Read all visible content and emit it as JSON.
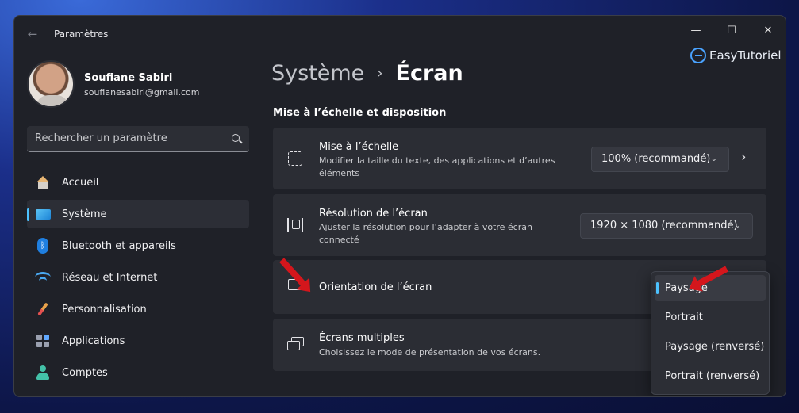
{
  "window": {
    "title": "Paramètres",
    "back_glyph": "←",
    "min_glyph": "—",
    "max_glyph": "☐",
    "close_glyph": "✕"
  },
  "watermark": {
    "text": "EasyTutoriel"
  },
  "user": {
    "name": "Soufiane Sabiri",
    "email": "soufianesabiri@gmail.com"
  },
  "search": {
    "placeholder": "Rechercher un paramètre"
  },
  "sidebar": {
    "items": [
      {
        "label": "Accueil",
        "icon": "home-icon"
      },
      {
        "label": "Système",
        "icon": "system-icon",
        "active": true
      },
      {
        "label": "Bluetooth et appareils",
        "icon": "bluetooth-icon"
      },
      {
        "label": "Réseau et Internet",
        "icon": "wifi-icon"
      },
      {
        "label": "Personnalisation",
        "icon": "brush-icon"
      },
      {
        "label": "Applications",
        "icon": "apps-icon"
      },
      {
        "label": "Comptes",
        "icon": "accounts-icon"
      }
    ]
  },
  "breadcrumb": {
    "parent": "Système",
    "separator": "›",
    "current": "Écran"
  },
  "section": {
    "title": "Mise à l’échelle et disposition"
  },
  "cards": {
    "scale": {
      "title": "Mise à l’échelle",
      "desc": "Modifier la taille du texte, des applications et d’autres éléments",
      "value": "100% (recommandé)",
      "chevron": "›"
    },
    "resolution": {
      "title": "Résolution de l’écran",
      "desc": "Ajuster la résolution pour l’adapter à  votre  écran connecté",
      "value": "1920 × 1080 (recommandé)"
    },
    "orientation": {
      "title": "Orientation de l’écran"
    },
    "multi": {
      "title": "Écrans multiples",
      "desc": "Choisissez le mode de présentation de vos écrans."
    }
  },
  "orientation_menu": {
    "options": [
      "Paysage",
      "Portrait",
      "Paysage (renversé)",
      "Portrait (renversé)"
    ],
    "selected": "Paysage"
  },
  "colors": {
    "accent": "#4cc2ff",
    "annotation_arrow": "#d4161c"
  }
}
